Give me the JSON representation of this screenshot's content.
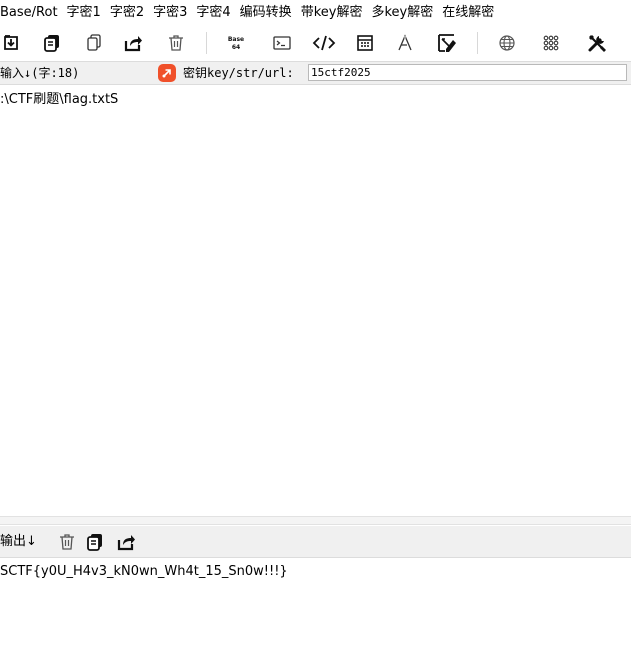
{
  "menubar": {
    "items": [
      "Base/Rot",
      "字密1",
      "字密2",
      "字密3",
      "字密4",
      "编码转换",
      "带key解密",
      "多key解密",
      "在线解密"
    ]
  },
  "toolbar": {
    "base_icon_text_top": "Base",
    "base_icon_text_bottom": "64"
  },
  "input_header": {
    "label": "输入↓(字:18)",
    "key_label": "密钥key/str/url:",
    "key_value": "15ctf2025",
    "key_icon_color": "#f0502a"
  },
  "input": {
    "text": ":\\CTF刷题\\flag.txtS"
  },
  "output_header": {
    "label": "输出↓"
  },
  "output": {
    "text": "SCTF{y0U_H4v3_kN0wn_Wh4t_15_Sn0w!!!}"
  }
}
